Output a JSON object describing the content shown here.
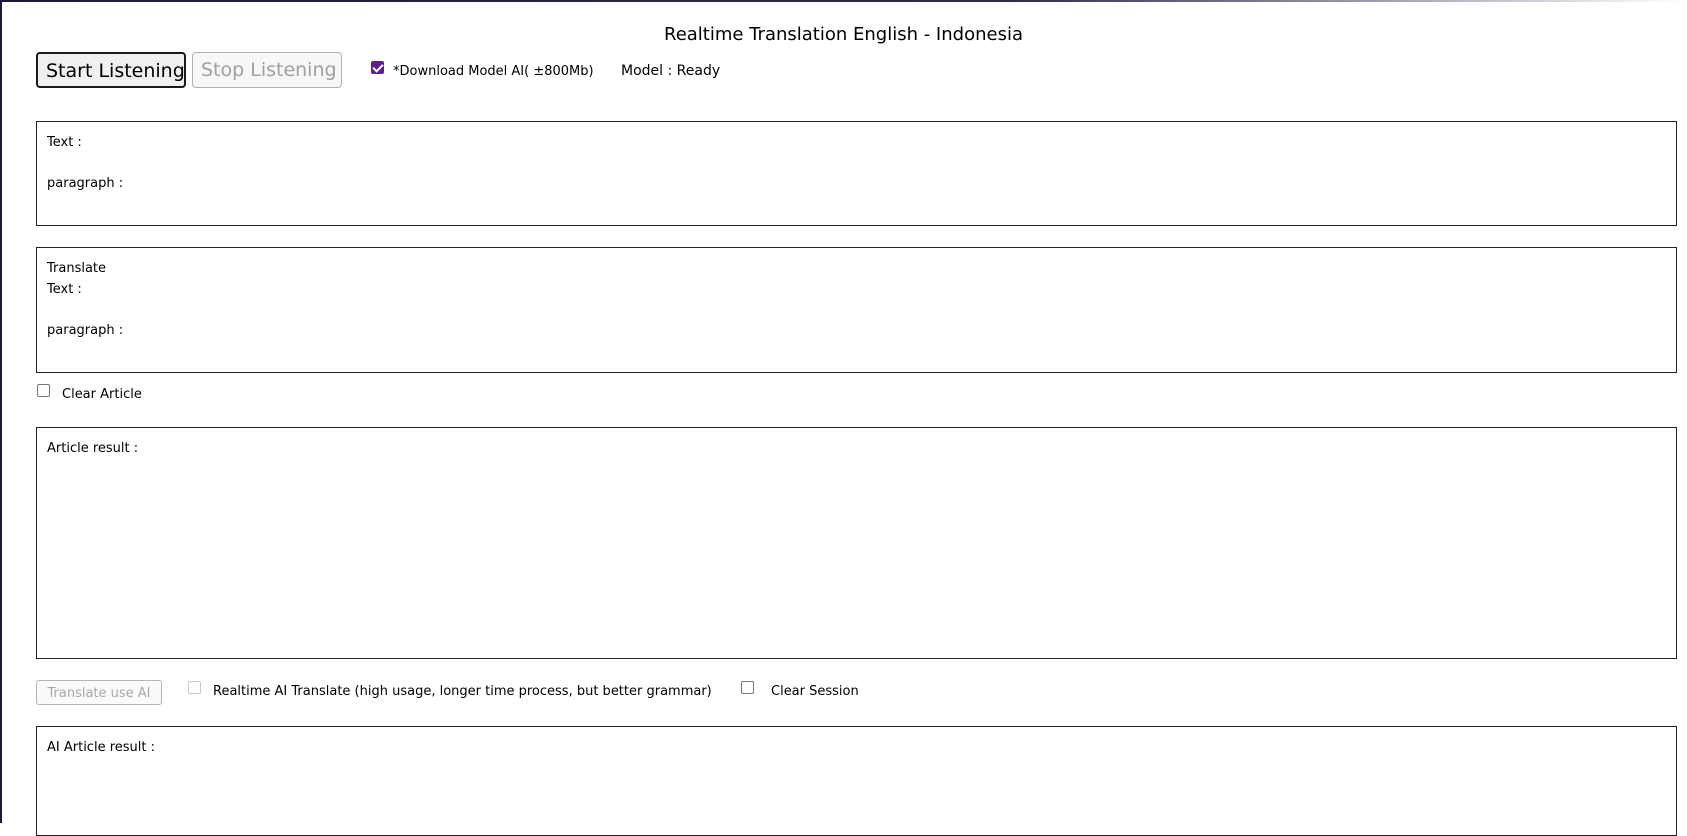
{
  "header": {
    "title": "Realtime Translation English - Indonesia"
  },
  "controls": {
    "start_label": "Start Listening",
    "stop_label": "Stop Listening",
    "download_model_label": "*Download Model AI( ±800Mb)",
    "download_model_checked": true,
    "model_status": "Model : Ready"
  },
  "source_box": {
    "text_label": "Text :",
    "paragraph_label": "paragraph :"
  },
  "translate_box": {
    "heading": "Translate",
    "text_label": "Text :",
    "paragraph_label": "paragraph :"
  },
  "clear_article": {
    "label": "Clear Article",
    "checked": false
  },
  "article_box": {
    "label": "Article result :"
  },
  "ai_controls": {
    "translate_button_label": "Translate use AI",
    "realtime_label": "Realtime AI Translate (high usage, longer time process, but better grammar)",
    "realtime_checked": false,
    "clear_session_label": "Clear Session",
    "clear_session_checked": false
  },
  "ai_article_box": {
    "label": "AI Article result :"
  },
  "colors": {
    "checkbox_accent": "#5e1e8c",
    "border": "#222222",
    "disabled_text": "#a8a8a8"
  }
}
